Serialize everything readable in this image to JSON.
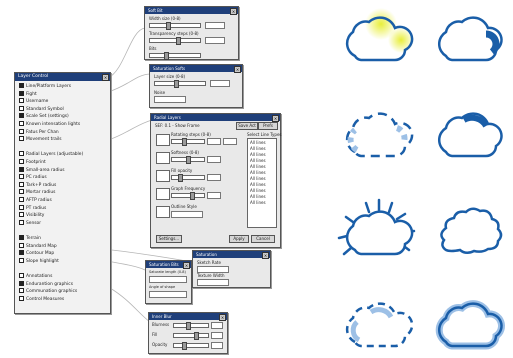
{
  "layer_control": {
    "title": "Layer Control",
    "rows": [
      {
        "label": "Line/Platform Layers",
        "checked": true
      },
      {
        "label": "Fight",
        "checked": true
      },
      {
        "label": "Username",
        "checked": false
      },
      {
        "label": "Standard Symbol",
        "checked": false
      },
      {
        "label": "Scale Set (settings)",
        "checked": true
      },
      {
        "label": "Known intensation lights",
        "checked": false
      },
      {
        "label": "Fatus Per Chan",
        "checked": false
      },
      {
        "label": "Movement trails",
        "checked": false
      },
      {
        "label": "",
        "checked": null
      },
      {
        "label": "Radial Layers (adjustable)",
        "checked": false
      },
      {
        "label": "Footprint",
        "checked": false
      },
      {
        "label": "Small-area radius",
        "checked": true
      },
      {
        "label": "PC radius",
        "checked": false
      },
      {
        "label": "Tark+P radius",
        "checked": false
      },
      {
        "label": "Mortar radius",
        "checked": false
      },
      {
        "label": "AFTP radius",
        "checked": false
      },
      {
        "label": "PT radius",
        "checked": false
      },
      {
        "label": "Visibility",
        "checked": false
      },
      {
        "label": "Sensor",
        "checked": false
      },
      {
        "label": "",
        "checked": null
      },
      {
        "label": "Terrain",
        "checked": true
      },
      {
        "label": "Standard Map",
        "checked": false
      },
      {
        "label": "Contour Map",
        "checked": true
      },
      {
        "label": "Slope highlight",
        "checked": false
      },
      {
        "label": "",
        "checked": null
      },
      {
        "label": "Annotations",
        "checked": false
      },
      {
        "label": "Endurantion graphics",
        "checked": true
      },
      {
        "label": "Communation graphics",
        "checked": false
      },
      {
        "label": "Control Measures",
        "checked": false
      }
    ]
  },
  "win_a": {
    "title": "Soft Bit",
    "labels": [
      "Width size (0-8)",
      "Transparency steps (0-8)",
      "Bits"
    ],
    "slider_levels": [
      0.35,
      0.55,
      0.3
    ]
  },
  "win_b": {
    "title": "Saturation Softs",
    "labels": [
      "Layer size (0-8)",
      "Noise"
    ],
    "slider_levels": [
      0.4,
      0.2
    ]
  },
  "win_c": {
    "title": "Radial Layers",
    "header": "SEF: 0.1 - Show Frame",
    "col_header": "Select Line Types",
    "section_labels": [
      "Rotating steps (0-8)",
      "Softness (0-8)",
      "Fill opacity",
      "Graph Frequency",
      "Outline Style"
    ],
    "list_items": [
      "All lines",
      "All lines",
      "All lines",
      "All lines",
      "All lines",
      "All lines",
      "All lines",
      "All lines",
      "All lines",
      "All lines",
      "All lines"
    ],
    "buttons": [
      "Settings...",
      "Apply",
      "Cancel"
    ],
    "menu_items": [
      "Save Act",
      "Prefs"
    ]
  },
  "win_d": {
    "title": "Saturation Bits",
    "labels": [
      "Saturate length (0-8)",
      "Angle of shape"
    ]
  },
  "win_e": {
    "title": "Saturation",
    "labels": [
      "Sketch Rate",
      "Texture Width"
    ]
  },
  "win_f": {
    "title": "Inner Blur",
    "labels": [
      "Blurness",
      "Fill",
      "Opacity"
    ]
  },
  "colors": {
    "stroke": "#1a5ea8",
    "highlight": "#e8ee3a",
    "titlebar": "#1f3f7a",
    "panel": "#e9e9e9"
  }
}
